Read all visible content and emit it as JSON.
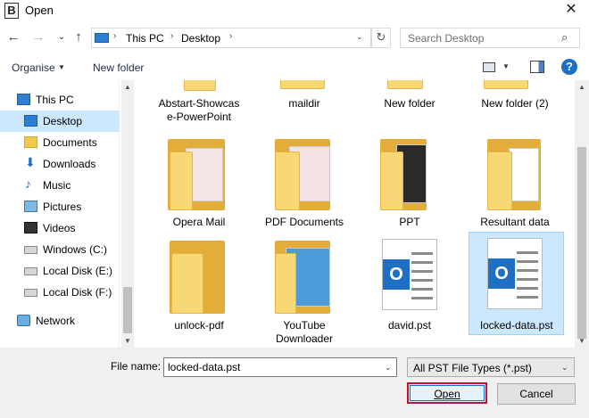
{
  "window": {
    "title": "Open",
    "app_icon_letter": "B",
    "close_glyph": "✕"
  },
  "nav": {
    "back": "←",
    "forward": "→",
    "recent": "⌄",
    "up": "↑"
  },
  "address": {
    "crumbs": [
      "This PC",
      "Desktop"
    ],
    "separator": "›",
    "dropdown": "⌄",
    "refresh": "↻"
  },
  "search": {
    "placeholder": "Search Desktop",
    "icon": "⌕"
  },
  "toolbar": {
    "organise_label": "Organise",
    "dropdown": "▼",
    "new_folder_label": "New folder",
    "help_label": "?"
  },
  "sidebar": {
    "items": [
      {
        "label": "This PC",
        "icon": "pc-icon",
        "selected": false
      },
      {
        "label": "Desktop",
        "icon": "desktop-icon",
        "selected": true
      },
      {
        "label": "Documents",
        "icon": "documents-icon",
        "selected": false
      },
      {
        "label": "Downloads",
        "icon": "downloads-icon",
        "selected": false
      },
      {
        "label": "Music",
        "icon": "music-icon",
        "selected": false
      },
      {
        "label": "Pictures",
        "icon": "pictures-icon",
        "selected": false
      },
      {
        "label": "Videos",
        "icon": "videos-icon",
        "selected": false
      },
      {
        "label": "Windows (C:)",
        "icon": "drive-icon",
        "selected": false
      },
      {
        "label": "Local Disk (E:)",
        "icon": "drive-icon",
        "selected": false
      },
      {
        "label": "Local Disk (F:)",
        "icon": "drive-icon",
        "selected": false
      },
      {
        "label": "Network",
        "icon": "network-icon",
        "selected": false
      }
    ]
  },
  "files": [
    {
      "label": "Abstart-Showcase-PowerPoint",
      "type": "folder"
    },
    {
      "label": "maildir",
      "type": "folder"
    },
    {
      "label": "New folder",
      "type": "folder"
    },
    {
      "label": "New folder (2)",
      "type": "folder"
    },
    {
      "label": "Opera Mail",
      "type": "folder"
    },
    {
      "label": "PDF Documents",
      "type": "folder"
    },
    {
      "label": "PPT",
      "type": "folder"
    },
    {
      "label": "Resultant data",
      "type": "folder"
    },
    {
      "label": "unlock-pdf",
      "type": "folder"
    },
    {
      "label": "YouTube Downloader",
      "type": "folder"
    },
    {
      "label": "david.pst",
      "type": "pst"
    },
    {
      "label": "locked-data.pst",
      "type": "pst",
      "selected": true
    }
  ],
  "file_labels_display": [
    "Abstart-Showcas",
    "e-PowerPoint",
    "YouTube",
    "Downloader"
  ],
  "pst_badge": "O",
  "bottom": {
    "file_name_label": "File name:",
    "file_name_value": "locked-data.pst",
    "file_type_value": "All PST File Types (*.pst)",
    "open_label": "Open",
    "cancel_label": "Cancel"
  },
  "colors": {
    "selection": "#cce8ff",
    "accent": "#0078d7",
    "focus_border": "#c8102e",
    "folder": "#f8d775",
    "pst_blue": "#1f6fc5"
  }
}
